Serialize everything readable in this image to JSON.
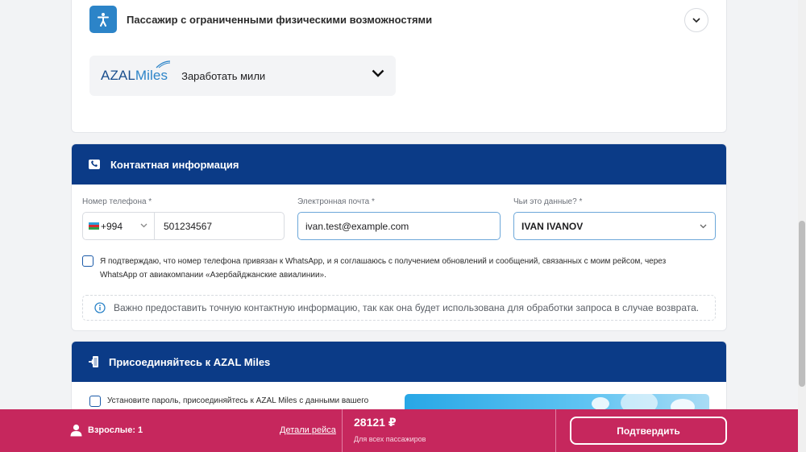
{
  "passenger_section": {
    "reduced_mobility_label": "Пассажир с ограниченными физическими возможностями",
    "miles_logo_part1": "AZAL",
    "miles_logo_part2": "Miles",
    "earn_miles_label": "Заработать мили"
  },
  "contact": {
    "header": "Контактная информация",
    "phone_label": "Номер телефона *",
    "country_code": "+994",
    "phone_value": "501234567",
    "email_label": "Электронная почта *",
    "email_value": "ivan.test@example.com",
    "owner_label": "Чьи это данные? *",
    "owner_value": "IVAN IVANOV",
    "whatsapp_consent": "Я подтверждаю, что номер телефона привязан к WhatsApp, и я соглашаюсь с получением обновлений и сообщений, связанных с моим рейсом, через WhatsApp от авиакомпании «Азербайджанские авиалинии».",
    "notice": "Важно предоставить точную контактную информацию, так как она будет использована для обработки запроса в случае возврата."
  },
  "azal_miles": {
    "header": "Присоединяйтесь к AZAL Miles",
    "join_text": "Установите пароль, присоединяйтесь к AZAL Miles с данными вашего"
  },
  "bottom_bar": {
    "adults": "Взрослые: 1",
    "flight_details": "Детали рейса",
    "price": "28121 ₽",
    "price_note": "Для всех пассажиров",
    "confirm": "Подтвердить"
  },
  "colors": {
    "brand_blue": "#0b3b87",
    "accent_blue": "#2c84c8",
    "bottom_bar": "#c6275d"
  }
}
